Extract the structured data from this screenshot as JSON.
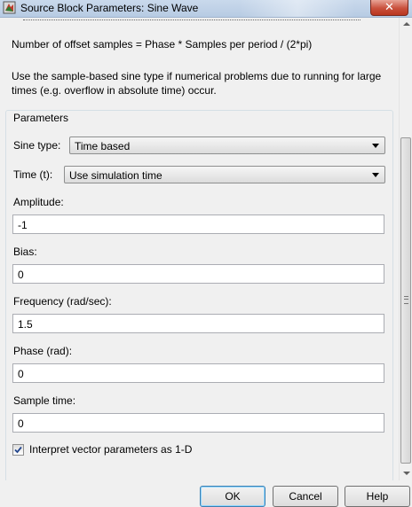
{
  "window": {
    "title": "Source Block Parameters: Sine Wave",
    "close_glyph": "✕"
  },
  "description": {
    "line1": "Number of offset samples = Phase * Samples per period / (2*pi)",
    "line2": "Use the sample-based sine type if numerical problems due to running for large times (e.g. overflow in absolute time) occur."
  },
  "parameters": {
    "group_label": "Parameters",
    "sine_type": {
      "label": "Sine type:",
      "value": "Time based"
    },
    "time": {
      "label": "Time (t):",
      "value": "Use simulation time"
    },
    "amplitude": {
      "label": "Amplitude:",
      "value": "-1"
    },
    "bias": {
      "label": "Bias:",
      "value": "0"
    },
    "frequency": {
      "label": "Frequency (rad/sec):",
      "value": "1.5"
    },
    "phase": {
      "label": "Phase (rad):",
      "value": "0"
    },
    "sample_time": {
      "label": "Sample time:",
      "value": "0"
    },
    "interpret_vector": {
      "label": "Interpret vector parameters as 1-D",
      "checked": true
    }
  },
  "buttons": {
    "ok": "OK",
    "cancel": "Cancel",
    "help": "Help"
  }
}
